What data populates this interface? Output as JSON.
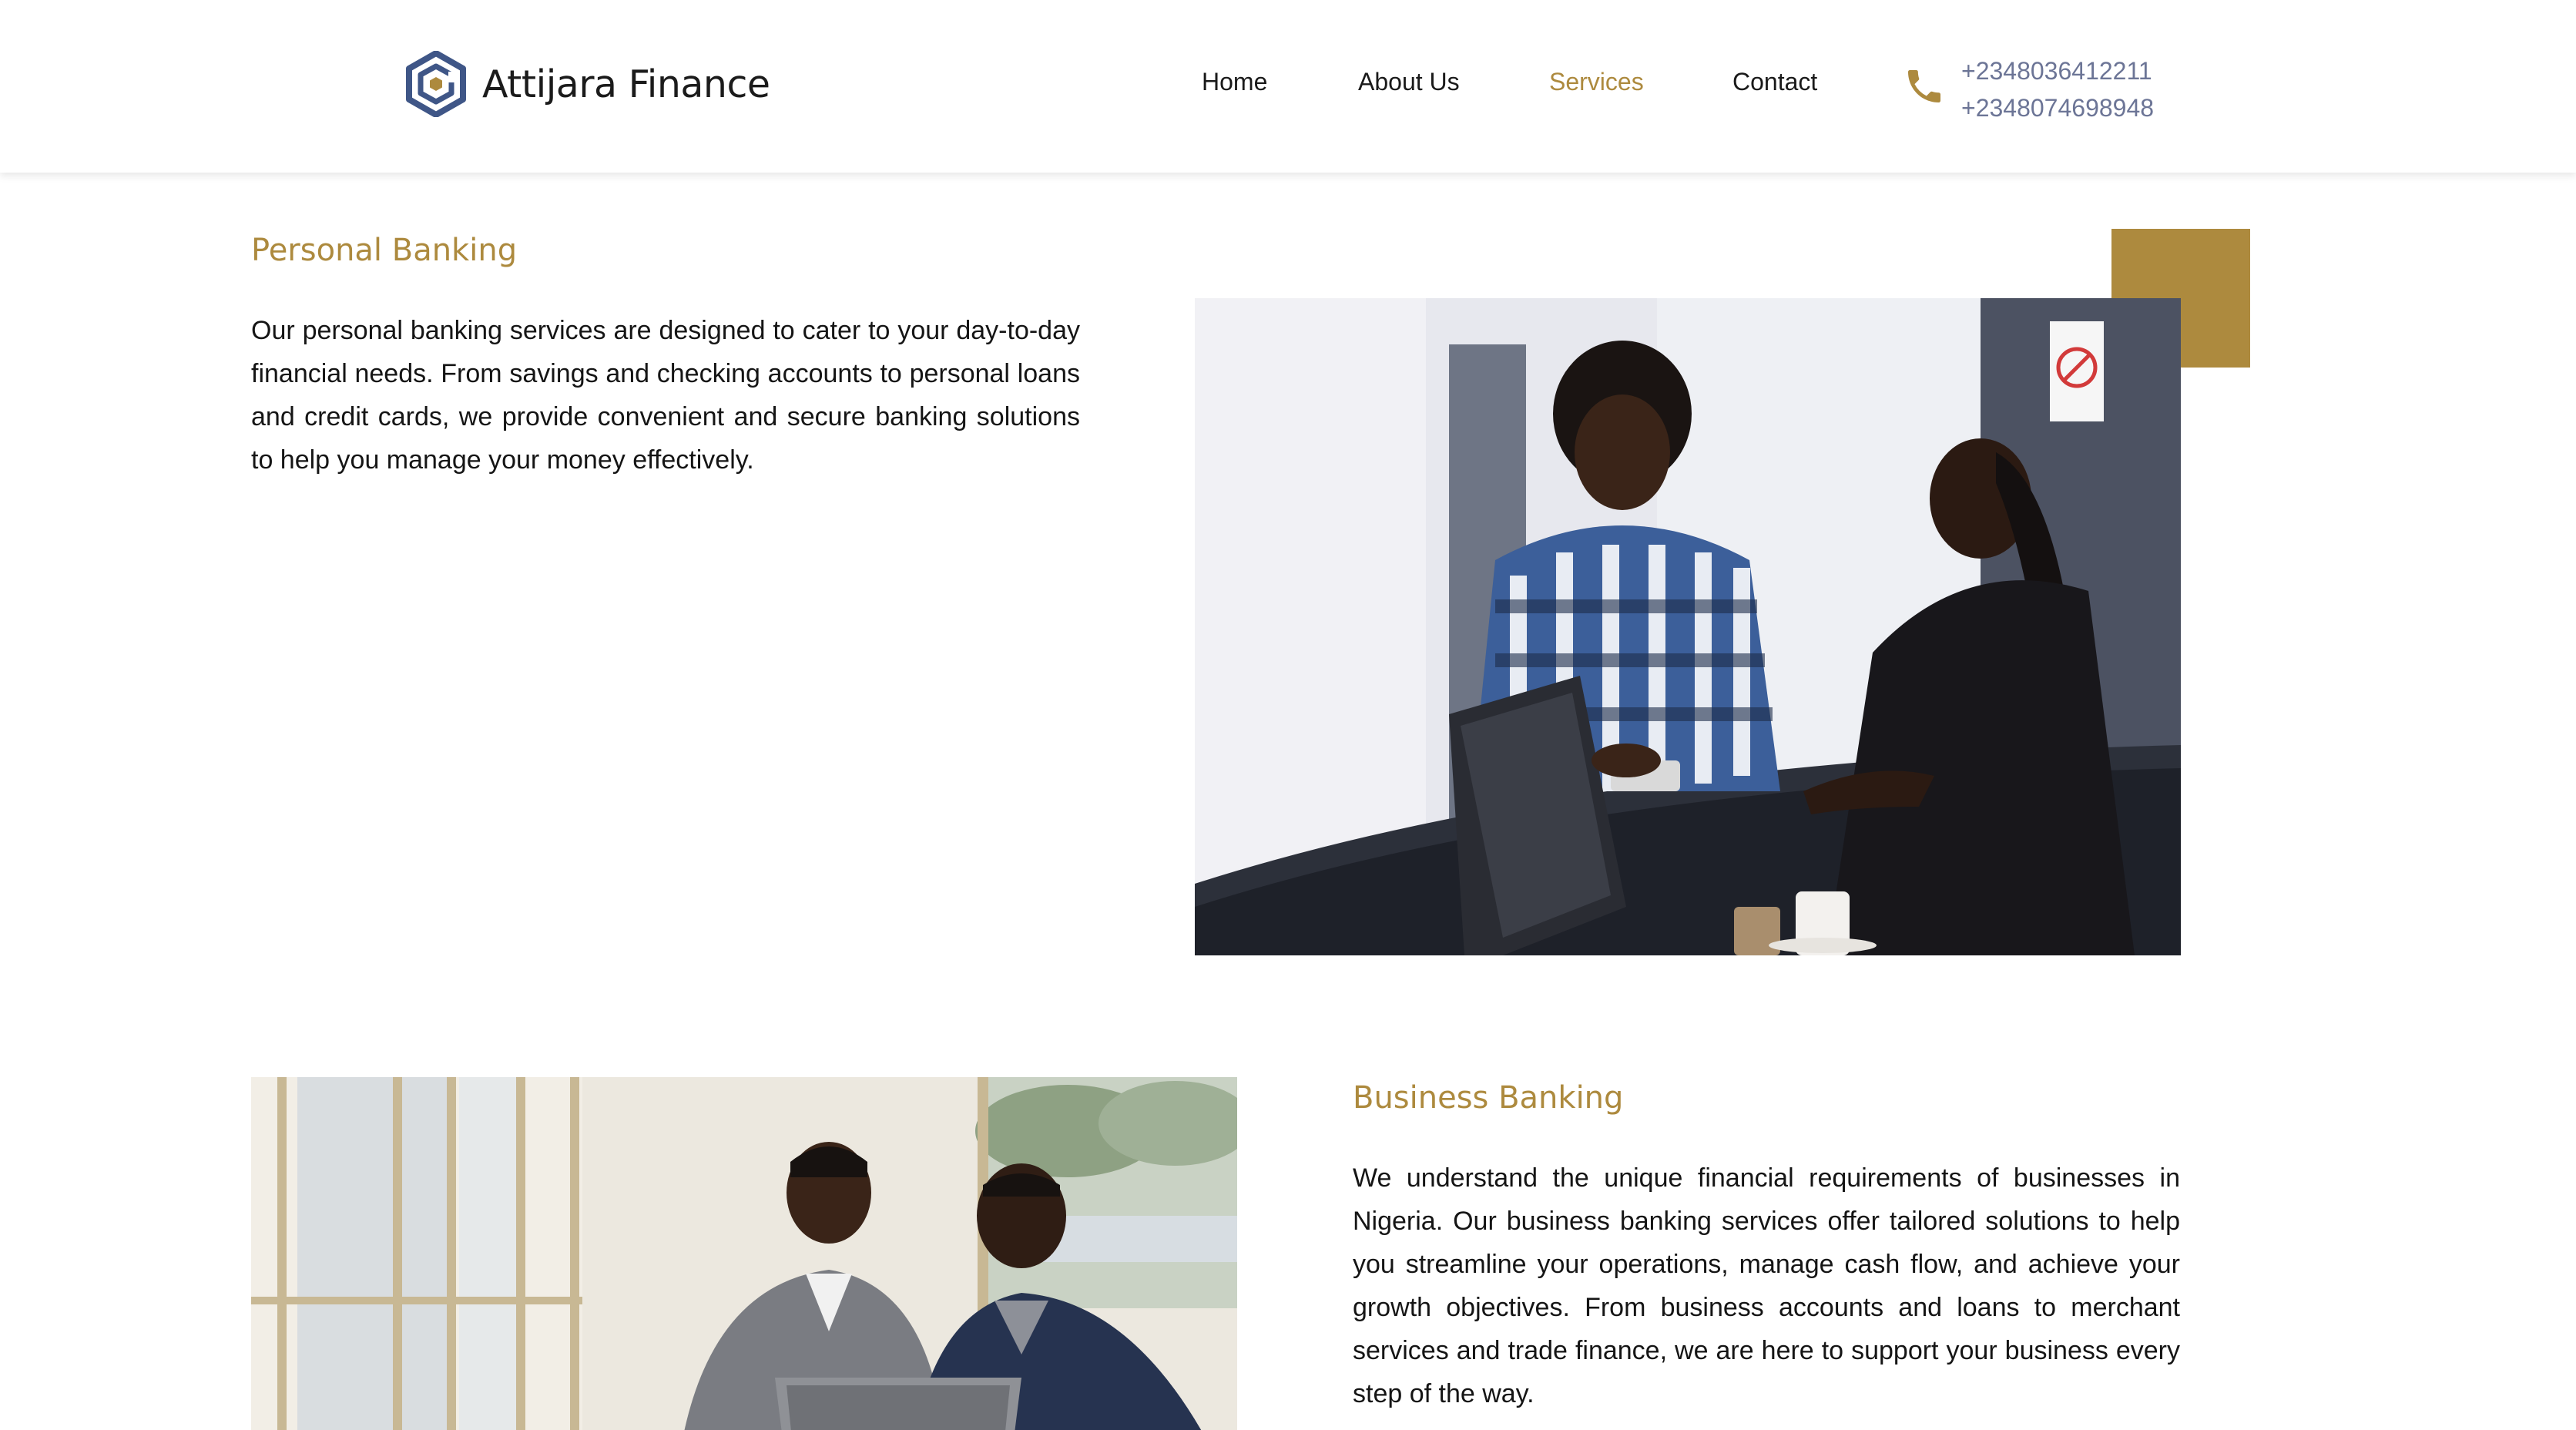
{
  "header": {
    "brand": "Attijara Finance",
    "nav": [
      {
        "label": "Home",
        "active": false
      },
      {
        "label": "About Us",
        "active": false
      },
      {
        "label": "Services",
        "active": true
      },
      {
        "label": "Contact",
        "active": false
      }
    ],
    "phones": [
      "+2348036412211",
      "+2348074698948"
    ]
  },
  "sections": {
    "personal": {
      "title": "Personal Banking",
      "text": "Our personal banking services are designed to cater to your day-to-day financial needs. From savings and checking accounts to personal loans and credit cards, we provide convenient and secure banking solutions to help you manage your money effectively."
    },
    "business": {
      "title": "Business Banking",
      "text": "We understand the unique financial requirements of businesses in Nigeria. Our business banking services offer tailored solutions to help you streamline your operations, manage cash flow, and achieve your growth objectives. From business accounts and loans to merchant services and trade finance, we are here to support your business every step of the way."
    }
  },
  "colors": {
    "accent": "#ad8a3e",
    "brand_blue": "#3f5687",
    "phone_text": "#6c7596",
    "text": "#151515"
  },
  "icons": {
    "logo": "hexagon-logo-icon",
    "phone": "phone-icon"
  }
}
